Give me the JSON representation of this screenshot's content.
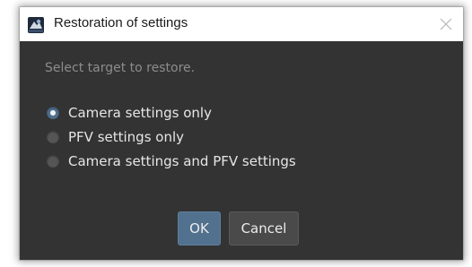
{
  "dialog": {
    "title": "Restoration of settings",
    "app_icon": "camera-app-icon",
    "close_icon": "close-icon"
  },
  "prompt": "Select target to restore.",
  "options": [
    {
      "label": "Camera settings only",
      "checked": true
    },
    {
      "label": "PFV settings only",
      "checked": false
    },
    {
      "label": "Camera settings and PFV settings",
      "checked": false
    }
  ],
  "buttons": {
    "ok_label": "OK",
    "cancel_label": "Cancel"
  },
  "colors": {
    "dialog_background": "#333333",
    "titlebar_background": "#ffffff",
    "accent": "#52718f",
    "prompt_text": "#8c8c8c",
    "option_text": "#e6e6e6"
  }
}
